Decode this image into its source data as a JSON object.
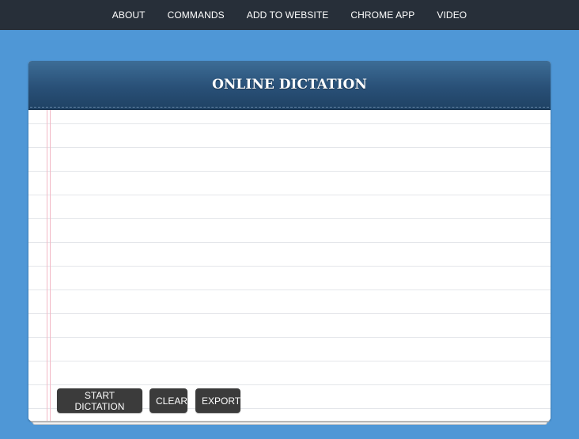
{
  "nav": {
    "items": [
      {
        "label": "ABOUT"
      },
      {
        "label": "COMMANDS"
      },
      {
        "label": "ADD TO WEBSITE"
      },
      {
        "label": "CHROME APP"
      },
      {
        "label": "VIDEO"
      }
    ]
  },
  "panel": {
    "title": "ONLINE DICTATION"
  },
  "editor": {
    "value": "",
    "placeholder": ""
  },
  "buttons": {
    "start_label": "START DICTATION",
    "clear_label": "CLEAR",
    "export_label": "EXPORT"
  },
  "colors": {
    "background": "#4f97d6",
    "nav_bar": "#272f39",
    "header": "#295077",
    "button": "#3b3b3b",
    "margin_line": "#f2b8c6"
  }
}
